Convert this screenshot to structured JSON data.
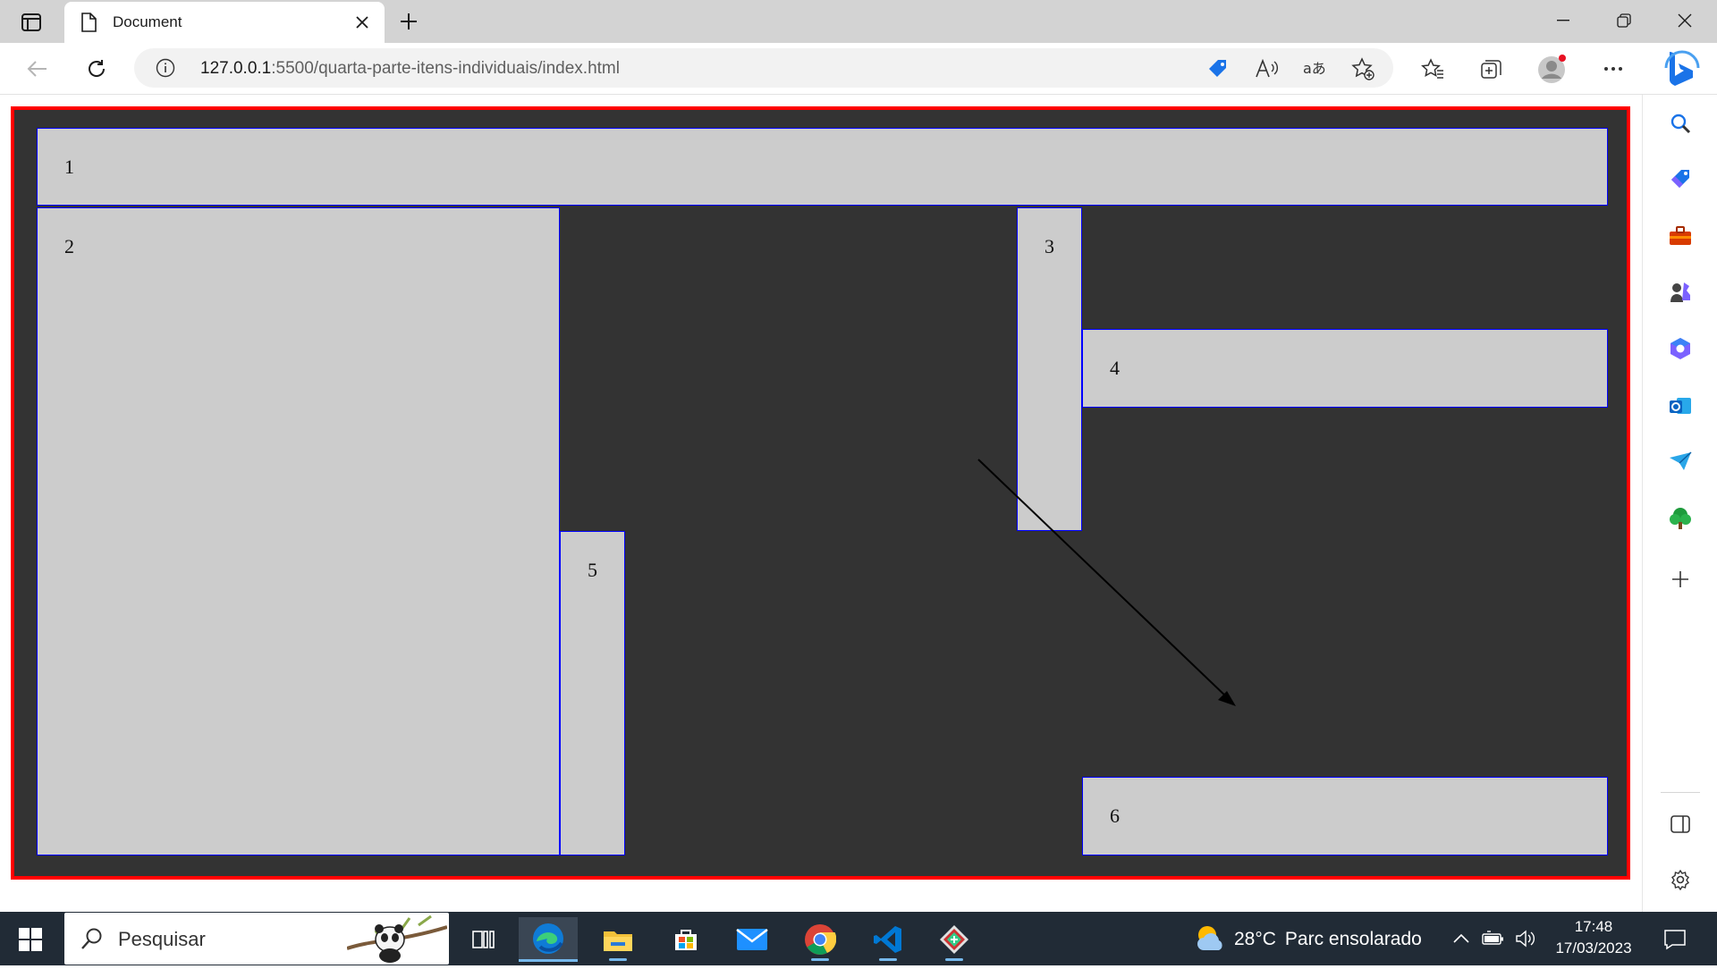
{
  "browser": {
    "tab_title": "Document",
    "url_host": "127.0.0.1",
    "url_path": ":5500/quarta-parte-itens-individuais/index.html"
  },
  "page": {
    "items": [
      {
        "label": "1"
      },
      {
        "label": "2"
      },
      {
        "label": "3"
      },
      {
        "label": "4"
      },
      {
        "label": "5"
      },
      {
        "label": "6"
      }
    ]
  },
  "colors": {
    "container_bg": "#333333",
    "container_border": "#ff0000",
    "item_bg": "#cccccc",
    "item_border": "#0000ff"
  },
  "sidebar_icons": [
    "search-icon",
    "shopping-tag-icon",
    "toolbox-icon",
    "games-icon",
    "office-icon",
    "outlook-icon",
    "send-icon",
    "tree-icon",
    "add-icon",
    "split-screen-icon",
    "settings-icon"
  ],
  "taskbar": {
    "search_placeholder": "Pesquisar",
    "weather_temp": "28°C",
    "weather_text": "Parc ensolarado",
    "time": "17:48",
    "date": "17/03/2023"
  }
}
